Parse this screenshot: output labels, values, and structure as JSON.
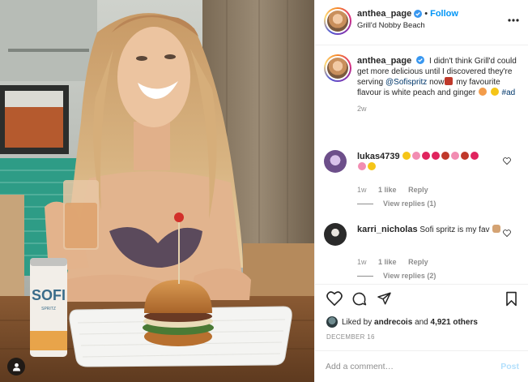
{
  "post": {
    "header": {
      "username": "anthea_page",
      "verified": true,
      "separator": "•",
      "follow_label": "Follow",
      "location": "Grill'd Nobby Beach",
      "more_icon": "more-dots-icon"
    },
    "caption": {
      "username": "anthea_page",
      "text_1": "I didn't think Grill'd could get more delicious until I discovered they're serving",
      "mention": "@Sofispritz",
      "text_2": "now",
      "text_3": "my favourite flavour is white peach and ginger",
      "hashtag": "#ad",
      "age": "2w"
    },
    "comments": [
      {
        "username": "lukas4739",
        "text": "",
        "emoji_note": "row of emoji only",
        "age": "1w",
        "likes": "1 like",
        "reply_label": "Reply",
        "view_replies": "View replies (1)"
      },
      {
        "username": "karri_nicholas",
        "text": "Sofi spritz is my fav",
        "age": "1w",
        "likes": "1 like",
        "reply_label": "Reply",
        "view_replies": "View replies (2)"
      }
    ],
    "actions": {
      "like_icon": "heart-icon",
      "comment_icon": "comment-icon",
      "share_icon": "paper-plane-icon",
      "save_icon": "bookmark-icon"
    },
    "liked_by": {
      "prefix": "Liked by",
      "user": "andrecois",
      "joiner": "and",
      "others": "4,921 others"
    },
    "date": "DECEMBER 16",
    "add_comment": {
      "placeholder": "Add a comment…",
      "post_label": "Post"
    },
    "photo": {
      "can_label": "SOFI",
      "can_sub": "SPRITZ",
      "tag_icon": "user-tag-icon"
    },
    "colors": {
      "link_blue": "#0095f6",
      "muted_gray": "#8e8e8e",
      "text": "#262626",
      "border": "#efefef"
    }
  }
}
